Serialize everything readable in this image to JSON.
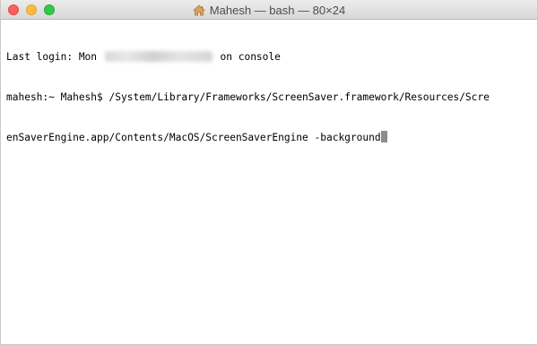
{
  "window": {
    "title": "Mahesh — bash — 80×24",
    "title_icon": "house-icon",
    "traffic_lights": {
      "close_color": "#fc605c",
      "minimize_color": "#fdbc40",
      "maximize_color": "#34c84a"
    }
  },
  "terminal": {
    "login_prefix": "Last login: Mon ",
    "login_suffix": " on console",
    "prompt": "mahesh:~ Mahesh$ ",
    "command_line1": "/System/Library/Frameworks/ScreenSaver.framework/Resources/Scre",
    "command_line2": "enSaverEngine.app/Contents/MacOS/ScreenSaverEngine -background"
  }
}
